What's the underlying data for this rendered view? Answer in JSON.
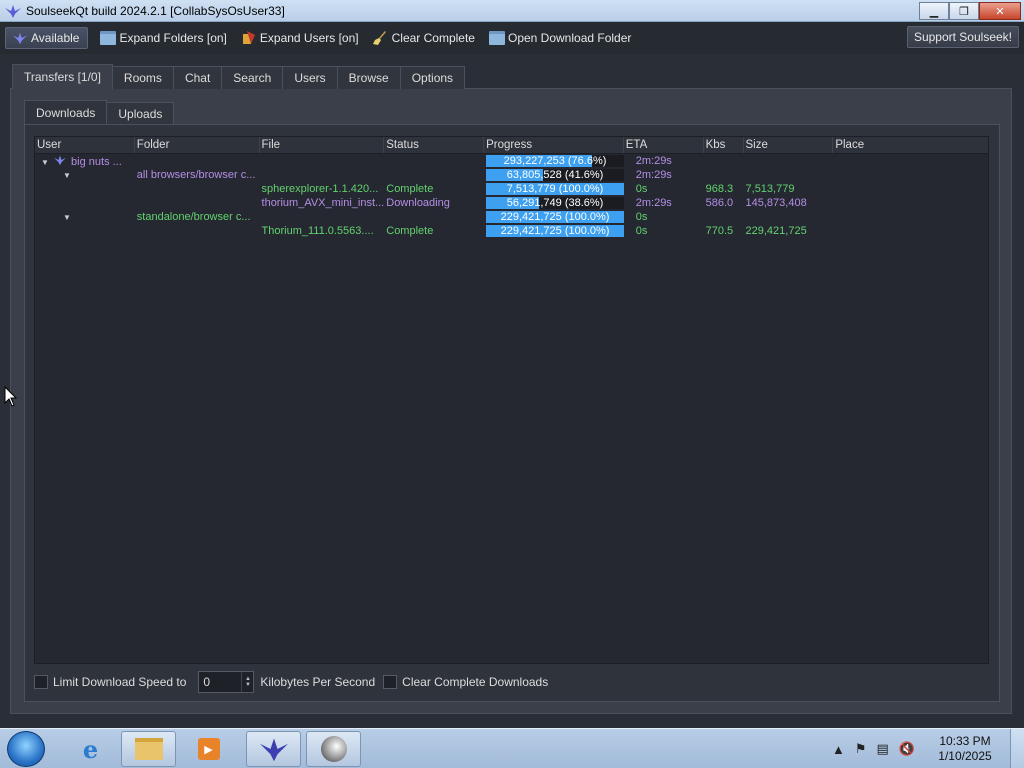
{
  "window": {
    "title": "SoulseekQt build 2024.2.1 [CollabSysOsUser33]",
    "minimize": "▁",
    "maximize": "❐",
    "close": "✕"
  },
  "toolbar": {
    "available": "Available",
    "expand_folders": "Expand Folders [on]",
    "expand_users": "Expand Users [on]",
    "clear_complete": "Clear Complete",
    "open_download_folder": "Open Download Folder",
    "support": "Support Soulseek!"
  },
  "tabs": [
    "Transfers [1/0]",
    "Rooms",
    "Chat",
    "Search",
    "Users",
    "Browse",
    "Options"
  ],
  "subtabs": [
    "Downloads",
    "Uploads"
  ],
  "columns": [
    "User",
    "Folder",
    "File",
    "Status",
    "Progress",
    "ETA",
    "Kbs",
    "Size",
    "Place"
  ],
  "rows": [
    {
      "user": "big nuts ...",
      "folder": "",
      "file": "",
      "status": "",
      "progress": "293,227,253 (76.6%)",
      "pct": 0.766,
      "eta": "2m:29s",
      "kbs": "",
      "size": "",
      "color": "purple"
    },
    {
      "user": "",
      "folder": "all browsers/browser c...",
      "file": "",
      "status": "",
      "progress": "63,805,528 (41.6%)",
      "pct": 0.416,
      "eta": "2m:29s",
      "kbs": "",
      "size": "",
      "color": "purple"
    },
    {
      "user": "",
      "folder": "",
      "file": "spherexplorer-1.1.420...",
      "status": "Complete",
      "progress": "7,513,779 (100.0%)",
      "pct": 1.0,
      "eta": "0s",
      "kbs": "968.3",
      "size": "7,513,779",
      "color": "green"
    },
    {
      "user": "",
      "folder": "",
      "file": "thorium_AVX_mini_inst...",
      "status": "Downloading",
      "progress": "56,291,749 (38.6%)",
      "pct": 0.386,
      "eta": "2m:29s",
      "kbs": "586.0",
      "size": "145,873,408",
      "color": "purple"
    },
    {
      "user": "",
      "folder": "standalone/browser c...",
      "file": "",
      "status": "",
      "progress": "229,421,725 (100.0%)",
      "pct": 1.0,
      "eta": "0s",
      "kbs": "",
      "size": "",
      "color": "green"
    },
    {
      "user": "",
      "folder": "",
      "file": "Thorium_111.0.5563....",
      "status": "Complete",
      "progress": "229,421,725 (100.0%)",
      "pct": 1.0,
      "eta": "0s",
      "kbs": "770.5",
      "size": "229,421,725",
      "color": "green"
    }
  ],
  "bottom": {
    "limit_label": "Limit Download Speed to",
    "limit_value": "0",
    "unit_label": "Kilobytes Per Second",
    "clear_label": "Clear Complete Downloads"
  },
  "taskbar": {
    "time": "10:33 PM",
    "date": "1/10/2025"
  }
}
